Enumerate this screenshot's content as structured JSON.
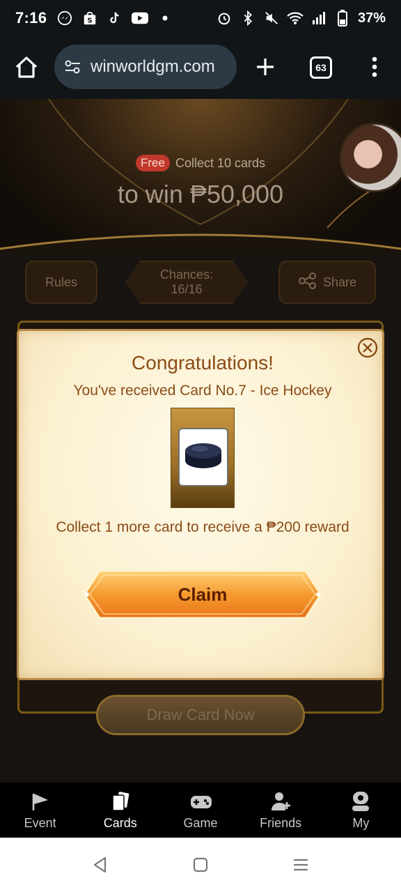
{
  "status_bar": {
    "time": "7:16",
    "battery": "37%",
    "icons": [
      "messenger-icon",
      "shopee-icon",
      "tiktok-icon",
      "youtube-icon",
      "dot-icon",
      "alarm-icon",
      "bluetooth-icon",
      "mute-icon",
      "wifi-icon",
      "signal-icon",
      "battery-icon"
    ]
  },
  "browser": {
    "url": "winworldgm.com",
    "tab_count": "63"
  },
  "hero": {
    "badge": "Free",
    "collect_text": "Collect 10 cards",
    "win_text": "to win ₱50,000"
  },
  "actions": {
    "rules": "Rules",
    "chances_label": "Chances:",
    "chances_value": "16/16",
    "share": "Share"
  },
  "draw_button": "Draw Card Now",
  "modal": {
    "title": "Congratulations!",
    "subtitle": "You've received Card No.7 - Ice Hockey",
    "reward_text": "Collect 1 more card to receive a ₱200 reward",
    "claim_label": "Claim",
    "card_icon": "hockey-puck-icon"
  },
  "tabbar": {
    "items": [
      {
        "label": "Event",
        "icon": "flag-icon"
      },
      {
        "label": "Cards",
        "icon": "cards-icon",
        "active": true
      },
      {
        "label": "Game",
        "icon": "gamepad-icon"
      },
      {
        "label": "Friends",
        "icon": "add-person-icon"
      },
      {
        "label": "My",
        "icon": "profile-icon"
      }
    ]
  },
  "colors": {
    "accent_gold": "#b78a4a",
    "modal_text": "#8a4b16",
    "claim_orange": "#f59a2e",
    "free_badge": "#c0392b"
  }
}
